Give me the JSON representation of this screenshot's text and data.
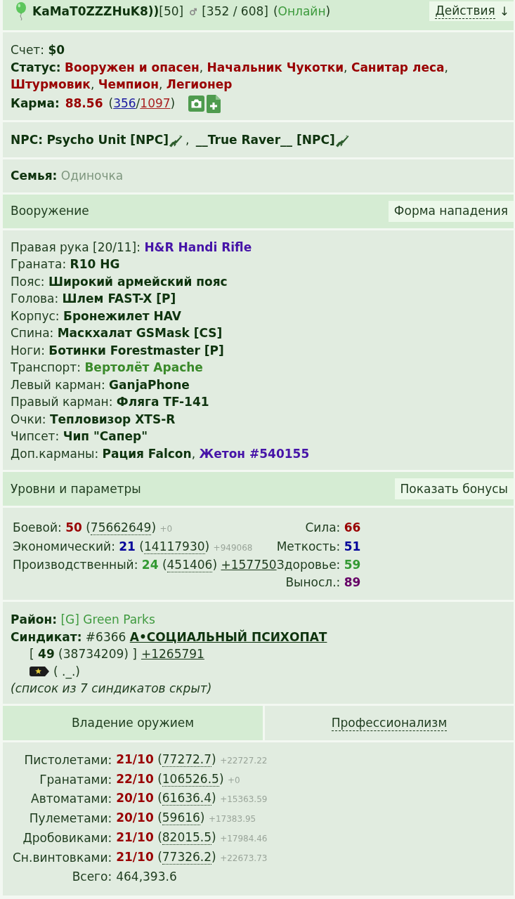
{
  "header": {
    "name": "KaMaT0ZZZHuK8))",
    "level": "[50]",
    "health": "[352 / 608]",
    "online": {
      "open": "(",
      "text": "Онлайн",
      "close": ")"
    },
    "actions": {
      "label": "Действия",
      "arrow": "↓"
    }
  },
  "account": {
    "label": "Счет:",
    "value": "$0"
  },
  "status": {
    "label": "Статус:",
    "titles": [
      {
        "text": "Вооружен и опасен",
        "sep": ","
      },
      {
        "text": "Начальник Чукотки",
        "sep": ","
      },
      {
        "text": "Санитар леса",
        "sep": ","
      },
      {
        "text": "Штурмовик",
        "sep": ","
      },
      {
        "text": "Чемпион",
        "sep": ","
      },
      {
        "text": "Легионер"
      }
    ]
  },
  "karma": {
    "label": "Карма:",
    "value": "88.56",
    "open": "(",
    "up": "356",
    "slash": "/",
    "down": "1097",
    "close": ")"
  },
  "npc": {
    "label": "NPC:",
    "items": [
      {
        "name": "Psycho Unit [NPC]",
        "sep": ","
      },
      {
        "name": "__True Raver__ [NPC]"
      }
    ]
  },
  "family": {
    "label": "Семья:",
    "value": "Одиночка"
  },
  "armament": {
    "title": "Вооружение",
    "button": "Форма нападения"
  },
  "equipment": [
    {
      "slot": "Правая рука [20/11]:",
      "items": [
        {
          "name": "H&R Handi Rifle",
          "color": "#4614a8"
        }
      ]
    },
    {
      "slot": "Граната:",
      "items": [
        {
          "name": "R10 HG",
          "color": "#0e330e"
        }
      ]
    },
    {
      "slot": "Пояс:",
      "items": [
        {
          "name": "Широкий армейский пояс",
          "color": "#0e330e"
        }
      ]
    },
    {
      "slot": "Голова:",
      "items": [
        {
          "name": "Шлем FAST-X [P]",
          "color": "#0e330e"
        }
      ]
    },
    {
      "slot": "Корпус:",
      "items": [
        {
          "name": "Бронежилет HAV",
          "color": "#0e330e"
        }
      ]
    },
    {
      "slot": "Спина:",
      "items": [
        {
          "name": "Маскхалат GSMask [CS]",
          "color": "#0e330e"
        }
      ]
    },
    {
      "slot": "Ноги:",
      "items": [
        {
          "name": "Ботинки Forestmaster [P]",
          "color": "#0e330e"
        }
      ]
    },
    {
      "slot": "Транспорт:",
      "items": [
        {
          "name": "Вертолёт Apache",
          "color": "#3a8a2a"
        }
      ]
    },
    {
      "slot": "Левый карман:",
      "items": [
        {
          "name": "GanjaPhone",
          "color": "#0e330e"
        }
      ]
    },
    {
      "slot": "Правый карман:",
      "items": [
        {
          "name": "Фляга TF-141",
          "color": "#0e330e"
        }
      ]
    },
    {
      "slot": "Очки:",
      "items": [
        {
          "name": "Тепловизор XTS-R",
          "color": "#0e330e"
        }
      ]
    },
    {
      "slot": "Чипсет:",
      "items": [
        {
          "name": "Чип \"Сапер\"",
          "color": "#0e330e"
        }
      ]
    },
    {
      "slot": "Доп.карманы:",
      "items": [
        {
          "name": "Рация Falcon",
          "color": "#0e330e",
          "sep": ","
        },
        {
          "name": "Жетон #540155",
          "color": "#4614a8"
        }
      ]
    }
  ],
  "levels_bar": {
    "title": "Уровни и параметры",
    "button": "Показать бонусы"
  },
  "levels": [
    {
      "label": "Боевой:",
      "value": "50",
      "color": "#990000",
      "experience": "(75662649)",
      "gain": {
        "text": "+0",
        "kind": "muted"
      }
    },
    {
      "label": "Экономический:",
      "value": "21",
      "color": "#000099",
      "experience": "(14117930)",
      "gain": {
        "text": "+949068",
        "kind": "muted"
      }
    },
    {
      "label": "Производственный:",
      "value": "24",
      "color": "#339933",
      "experience": "(451406)",
      "gain": {
        "text": "+157750",
        "kind": "link"
      }
    }
  ],
  "stats": [
    {
      "label": "Сила:",
      "value": "66",
      "color": "#990000"
    },
    {
      "label": "Меткость:",
      "value": "51",
      "color": "#000099"
    },
    {
      "label": "Здоровье:",
      "value": "59",
      "color": "#339933"
    },
    {
      "label": "Выносл.:",
      "value": "89",
      "color": "#660066"
    }
  ],
  "district": {
    "label": "Район:",
    "value": "[G] Green Parks"
  },
  "syndicate": {
    "label": "Синдикат:",
    "number": "#6366",
    "name": "А•СОЦИАЛЬНЫЙ ПСИХОПАТ",
    "level": "[ **49** (38734209) ]",
    "gain": "+1265791",
    "rank": "( ._.)",
    "note": "(список из 7 синдикатов скрыт)"
  },
  "tabs": [
    {
      "label": "Владение оружием",
      "selected": true
    },
    {
      "label": "Профессионализм",
      "selected": false
    }
  ],
  "weapons": [
    {
      "label": "Пистолетами:",
      "value": "21/10",
      "experience": "(77272.7)",
      "gain": "+22727.22"
    },
    {
      "label": "Гранатами:",
      "value": "22/10",
      "experience": "(106526.5)",
      "gain": "+0"
    },
    {
      "label": "Автоматами:",
      "value": "20/10",
      "experience": "(61636.4)",
      "gain": "+15363.59"
    },
    {
      "label": "Пулеметами:",
      "value": "20/10",
      "experience": "(59616)",
      "gain": "+17383.95"
    },
    {
      "label": "Дробовиками:",
      "value": "21/10",
      "experience": "(82015.5)",
      "gain": "+17984.46"
    },
    {
      "label": "Сн.винтовками:",
      "value": "21/10",
      "experience": "(77326.2)",
      "gain": "+22673.73"
    }
  ],
  "total": {
    "label": "Всего:",
    "value": "464,393.6"
  }
}
